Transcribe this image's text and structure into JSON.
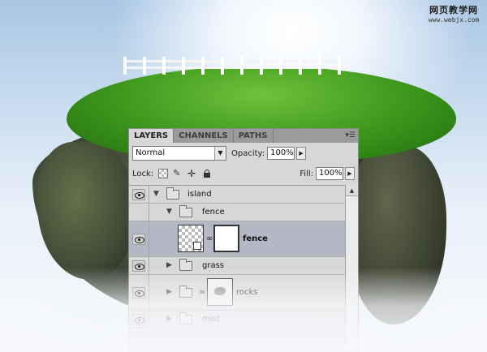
{
  "watermark": {
    "line1": "网页教学网",
    "line2": "www.webjx.com"
  },
  "panel": {
    "tabs": [
      "LAYERS",
      "CHANNELS",
      "PATHS"
    ],
    "menu_icon": "panel-menu-icon",
    "blend_mode": "Normal",
    "opacity_label": "Opacity:",
    "opacity_value": "100%",
    "lock_label": "Lock:",
    "fill_label": "Fill:",
    "fill_value": "100%",
    "layers": [
      {
        "name": "island",
        "type": "group",
        "expanded": true
      },
      {
        "name": "fence",
        "type": "group",
        "expanded": true
      },
      {
        "name": "fence",
        "type": "smart-object-with-mask",
        "selected": true
      },
      {
        "name": "grass",
        "type": "group",
        "expanded": false
      },
      {
        "name": "rocks",
        "type": "group-with-mask",
        "expanded": false
      },
      {
        "name": "mist",
        "type": "group",
        "expanded": false
      }
    ]
  },
  "colors": {
    "panel_bg": "#d7d7d7",
    "selected_row": "#b4b8c4",
    "tab_bar": "#9b9b9b"
  }
}
